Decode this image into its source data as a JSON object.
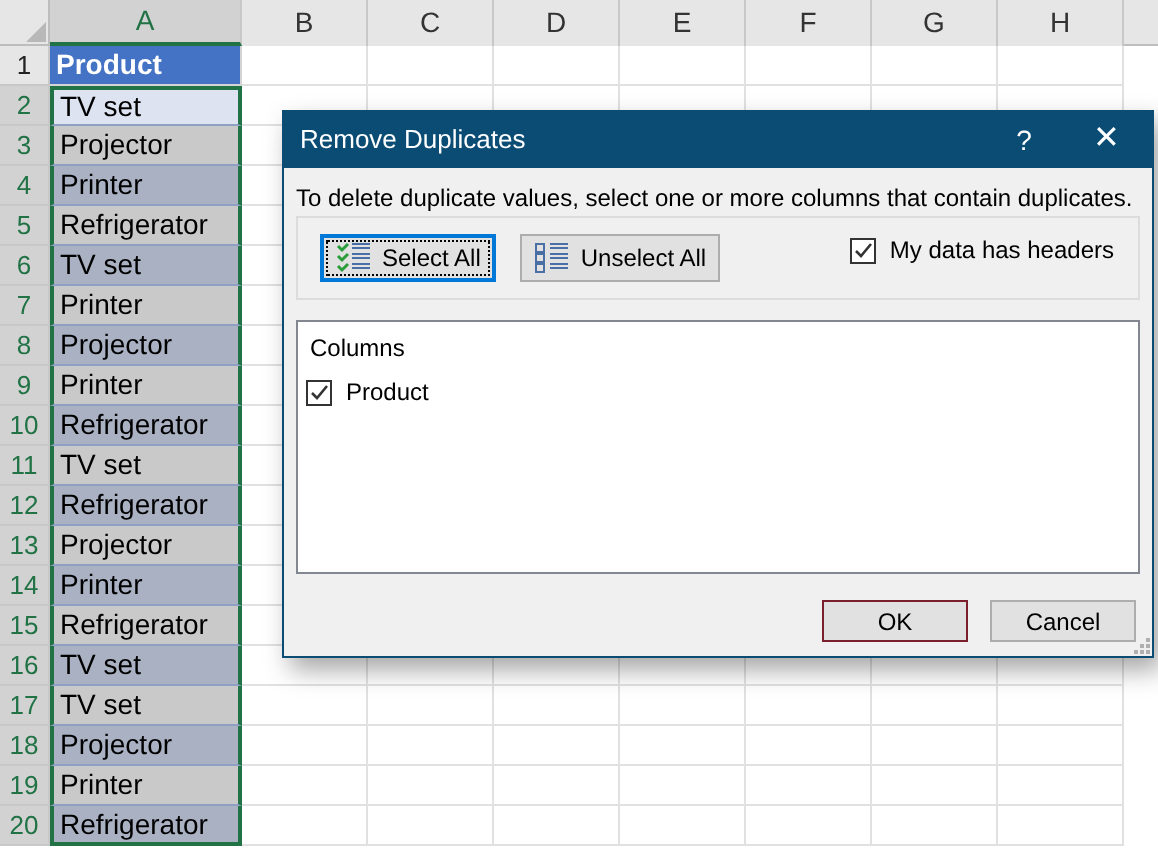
{
  "sheet": {
    "columns": [
      {
        "label": "A",
        "selected": true
      },
      {
        "label": "B",
        "selected": false
      },
      {
        "label": "C",
        "selected": false
      },
      {
        "label": "D",
        "selected": false
      },
      {
        "label": "E",
        "selected": false
      },
      {
        "label": "F",
        "selected": false
      },
      {
        "label": "G",
        "selected": false
      },
      {
        "label": "H",
        "selected": false
      }
    ],
    "rows": [
      {
        "number": "1",
        "selected": false,
        "cell": "Product",
        "kind": "header"
      },
      {
        "number": "2",
        "selected": true,
        "cell": "TV set",
        "kind": "active"
      },
      {
        "number": "3",
        "selected": true,
        "cell": "Projector",
        "kind": "data",
        "highlighted": false
      },
      {
        "number": "4",
        "selected": true,
        "cell": "Printer",
        "kind": "data",
        "highlighted": true
      },
      {
        "number": "5",
        "selected": true,
        "cell": "Refrigerator",
        "kind": "data",
        "highlighted": false
      },
      {
        "number": "6",
        "selected": true,
        "cell": "TV set",
        "kind": "data",
        "highlighted": true
      },
      {
        "number": "7",
        "selected": true,
        "cell": "Printer",
        "kind": "data",
        "highlighted": false
      },
      {
        "number": "8",
        "selected": true,
        "cell": "Projector",
        "kind": "data",
        "highlighted": true
      },
      {
        "number": "9",
        "selected": true,
        "cell": "Printer",
        "kind": "data",
        "highlighted": false
      },
      {
        "number": "10",
        "selected": true,
        "cell": "Refrigerator",
        "kind": "data",
        "highlighted": true
      },
      {
        "number": "11",
        "selected": true,
        "cell": "TV set",
        "kind": "data",
        "highlighted": false
      },
      {
        "number": "12",
        "selected": true,
        "cell": "Refrigerator",
        "kind": "data",
        "highlighted": true
      },
      {
        "number": "13",
        "selected": true,
        "cell": "Projector",
        "kind": "data",
        "highlighted": false
      },
      {
        "number": "14",
        "selected": true,
        "cell": "Printer",
        "kind": "data",
        "highlighted": true
      },
      {
        "number": "15",
        "selected": true,
        "cell": "Refrigerator",
        "kind": "data",
        "highlighted": false
      },
      {
        "number": "16",
        "selected": true,
        "cell": "TV set",
        "kind": "data",
        "highlighted": true
      },
      {
        "number": "17",
        "selected": true,
        "cell": "TV set",
        "kind": "data",
        "highlighted": false
      },
      {
        "number": "18",
        "selected": true,
        "cell": "Projector",
        "kind": "data",
        "highlighted": true
      },
      {
        "number": "19",
        "selected": true,
        "cell": "Printer",
        "kind": "data",
        "highlighted": false
      },
      {
        "number": "20",
        "selected": true,
        "cell": "Refrigerator",
        "kind": "data",
        "highlighted": true
      }
    ]
  },
  "dialog": {
    "title": "Remove Duplicates",
    "help": "?",
    "close": "✕",
    "instruction": "To delete duplicate values, select one or more columns that contain duplicates.",
    "select_all": {
      "label": "Select All",
      "focused": true
    },
    "unselect_all": {
      "label": "Unselect All",
      "focused": false
    },
    "headers_checkbox": {
      "label": "My data has headers",
      "checked": true
    },
    "columns_label": "Columns",
    "columns": [
      {
        "label": "Product",
        "checked": true
      }
    ],
    "buttons": [
      {
        "label": "OK",
        "default": true
      },
      {
        "label": "Cancel",
        "default": false
      }
    ]
  }
}
